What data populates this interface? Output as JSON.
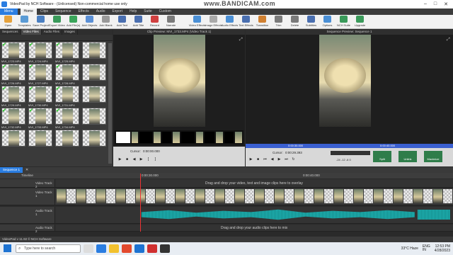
{
  "window": {
    "title": "VideoPad by NCH Software - (Unlicensed) Non-commercial home use only",
    "watermark": "www.BANDICAM.com"
  },
  "menubar": {
    "menu_label": "Menu",
    "tabs": [
      "Home",
      "Clips",
      "Sequence",
      "Effects",
      "Audio",
      "Export",
      "Help",
      "Suite",
      "Custom"
    ],
    "active": "Home"
  },
  "toolbar": {
    "buttons": [
      {
        "label": "Open",
        "color": "#e6a23c"
      },
      {
        "label": "Templates",
        "color": "#5a9bd5"
      },
      {
        "label": "Save Project",
        "color": "#4a7fc1"
      },
      {
        "label": "Export Video",
        "color": "#3a9a5a"
      },
      {
        "label": "Add File(s)",
        "color": "#3aa55a"
      },
      {
        "label": "Add Objects",
        "color": "#5a8fd5"
      },
      {
        "label": "Add Blank",
        "color": "#999999"
      },
      {
        "label": "Add Text",
        "color": "#4a6fb0"
      },
      {
        "label": "Add Title",
        "color": "#4a6fb0"
      },
      {
        "label": "Record",
        "color": "#d04040"
      },
      {
        "label": "Narrate",
        "color": "#7a7a7a"
      }
    ],
    "buttons_right": [
      {
        "label": "Video Effects",
        "color": "#4a8fd5"
      },
      {
        "label": "Image Effects",
        "color": "#aaaaaa"
      },
      {
        "label": "Audio Effects",
        "color": "#4a8fd5"
      },
      {
        "label": "Text Effects",
        "color": "#4a6fb0"
      },
      {
        "label": "Transition",
        "color": "#d08030"
      },
      {
        "label": "Trim",
        "color": "#7a7a7a"
      },
      {
        "label": "Delete",
        "color": "#7a7a7a"
      },
      {
        "label": "Subtitles",
        "color": "#4a6fb0"
      },
      {
        "label": "Options",
        "color": "#4a8fd5"
      },
      {
        "label": "NCH Suite",
        "color": "#3a9a5a"
      },
      {
        "label": "Upgrade",
        "color": "#3a9a5a"
      }
    ]
  },
  "bin": {
    "tabs": [
      "Sequences",
      "Video Files",
      "Audio Files",
      "Images"
    ],
    "active_tab": "Video Files",
    "clips": [
      "MVI_1723.MP4",
      "MVI_1724.MP4",
      "MVI_1725.MP4",
      "",
      "MVI_1726.MP4",
      "MVI_1727.MP4",
      "MVI_1728.MP4",
      "",
      "MVI_1729.MP4",
      "MVI_1730.MP4",
      "MVI_1731.MP4",
      "",
      "MVI_1732.MP4",
      "MVI_1733.MP4",
      "MVI_1734.MP4",
      "",
      "",
      "",
      "",
      ""
    ]
  },
  "clip_preview": {
    "header": "Clip Preview: MVI_1733.MP4 (Video Track 1)",
    "cursor_label": "Cursor:",
    "cursor_time": "0:00:00.000"
  },
  "seq_preview": {
    "header": "Sequence Preview: Sequence 1",
    "ruler_left": "0:00:30.000",
    "ruler_right": "0:00:40.000",
    "cursor_label": "Cursor:",
    "cursor_time": "0:00:29.393",
    "split_label": "Split",
    "unlink_label": "Unlink",
    "maximize_label": "Maximize",
    "db_marks": "-24 -12 -6 0"
  },
  "timeline": {
    "tab": "Sequence 1",
    "ruler_label": "Timeline",
    "ruler_marks": [
      "0:00:30.000",
      "0:00:40.000"
    ],
    "overlay_track": "Video Track 2",
    "overlay_msg": "Drag and drop your video, text and image clips here to overlay",
    "video_track": "Video Track 1",
    "audio_track": "Audio Track 1",
    "audio_track2": "Audio Track 2",
    "audio_msg": "Drag and drop your audio clips here to mix"
  },
  "status": {
    "text": "VideoPad v 11.92 © NCH Software"
  },
  "taskbar": {
    "search_placeholder": "Type here to search",
    "weather": "33°C Haze",
    "lang": "ENG\nIN",
    "time": "12:53 PM",
    "date": "4/28/2023"
  }
}
